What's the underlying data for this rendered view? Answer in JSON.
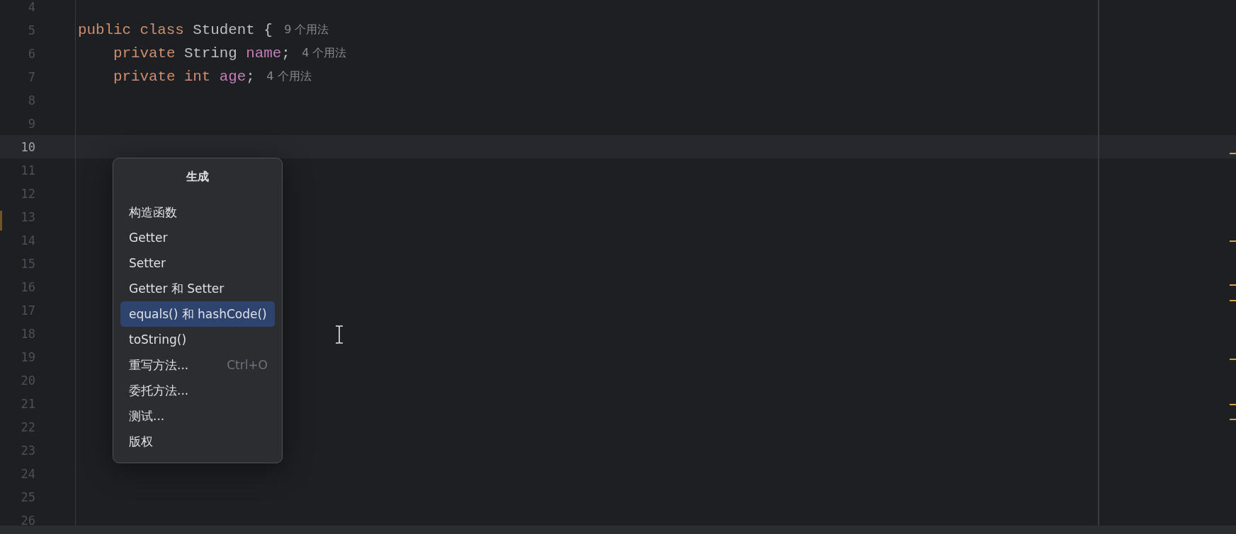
{
  "editor": {
    "lines": [
      {
        "number": "4",
        "current": false
      },
      {
        "number": "5",
        "current": false,
        "indent": false,
        "tokens": [
          {
            "kind": "keyword",
            "text": "public"
          },
          {
            "kind": "keyword",
            "text": "class"
          },
          {
            "kind": "type",
            "text": "Student"
          },
          {
            "kind": "plain",
            "text": "{"
          }
        ],
        "hint": "9 个用法"
      },
      {
        "number": "6",
        "current": false,
        "indent": true,
        "tokens": [
          {
            "kind": "keyword",
            "text": "private"
          },
          {
            "kind": "type",
            "text": "String"
          },
          {
            "kind": "field",
            "text": "name"
          },
          {
            "kind": "plain",
            "text": ";"
          }
        ],
        "hint": "4 个用法"
      },
      {
        "number": "7",
        "current": false,
        "indent": true,
        "tokens": [
          {
            "kind": "keyword",
            "text": "private"
          },
          {
            "kind": "keyword",
            "text": "int"
          },
          {
            "kind": "field",
            "text": "age"
          },
          {
            "kind": "plain",
            "text": ";"
          }
        ],
        "hint": "4 个用法"
      },
      {
        "number": "8",
        "current": false
      },
      {
        "number": "9",
        "current": false
      },
      {
        "number": "10",
        "current": true
      },
      {
        "number": "11",
        "current": false
      },
      {
        "number": "12",
        "current": false
      },
      {
        "number": "13",
        "current": false
      },
      {
        "number": "14",
        "current": false
      },
      {
        "number": "15",
        "current": false
      },
      {
        "number": "16",
        "current": false
      },
      {
        "number": "17",
        "current": false
      },
      {
        "number": "18",
        "current": false
      },
      {
        "number": "19",
        "current": false
      },
      {
        "number": "20",
        "current": false
      },
      {
        "number": "21",
        "current": false
      },
      {
        "number": "22",
        "current": false
      },
      {
        "number": "23",
        "current": false
      },
      {
        "number": "24",
        "current": false
      },
      {
        "number": "25",
        "current": false
      },
      {
        "number": "26",
        "current": false
      }
    ]
  },
  "popup": {
    "title": "生成",
    "items": [
      {
        "label": "构造函数",
        "selected": false
      },
      {
        "label": "Getter",
        "selected": false
      },
      {
        "label": "Setter",
        "selected": false
      },
      {
        "label": "Getter 和 Setter",
        "selected": false
      },
      {
        "label": "equals() 和 hashCode()",
        "selected": true
      },
      {
        "label": "toString()",
        "selected": false
      },
      {
        "label": "重写方法...",
        "shortcut": "Ctrl+O",
        "selected": false
      },
      {
        "label": "委托方法...",
        "selected": false
      },
      {
        "label": "测试...",
        "selected": false
      },
      {
        "label": "版权",
        "selected": false
      }
    ]
  }
}
